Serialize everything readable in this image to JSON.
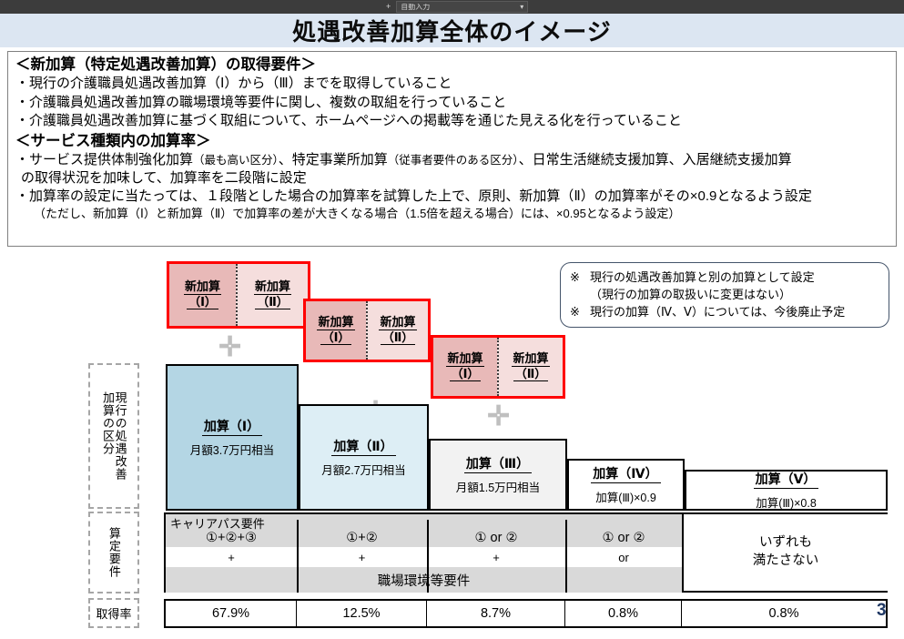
{
  "browser": {
    "plus_label": "+",
    "autofill_select": "自動入力",
    "caret": "▾"
  },
  "slide": {
    "title": "処遇改善加算全体のイメージ",
    "page_number": "3"
  },
  "requirements_box": {
    "section1_heading": "＜新加算（特定処遇改善加算）の取得要件＞",
    "section1_bullets": [
      "現行の介護職員処遇改善加算（Ⅰ）から（Ⅲ）までを取得していること",
      "介護職員処遇改善加算の職場環境等要件に関し、複数の取組を行っていること",
      "介護職員処遇改善加算に基づく取組について、ホームページへの掲載等を通じた見える化を行っていること"
    ],
    "section2_heading": "＜サービス種類内の加算率＞",
    "section2_bullet1_a": "サービス提供体制強化加算",
    "section2_bullet1_b": "（最も高い区分）",
    "section2_bullet1_c": "、特定事業所加算",
    "section2_bullet1_d": "（従事者要件のある区分）",
    "section2_bullet1_e": "、日常生活継続支援加算、入居継続支援加算",
    "section2_bullet1_cont": "の取得状況を加味して、加算率を二段階に設定",
    "section2_bullet2": "加算率の設定に当たっては、１段階とした場合の加算率を試算した上で、原則、新加算（Ⅱ）の加算率がその×0.9となるよう設定",
    "section2_bullet2_sub": "（ただし、新加算（Ⅰ）と新加算（Ⅱ）で加算率の差が大きくなる場合（1.5倍を超える場合）には、×0.95となるよう設定）",
    "bullet_marker": "・"
  },
  "note": {
    "marker": "※",
    "line1": "現行の処遇改善加算と別の加算として設定",
    "line2": "（現行の加算の取扱いに変更はない）",
    "line3": "現行の加算（Ⅳ、Ⅴ）については、今後廃止予定"
  },
  "new_kasan_groups": [
    {
      "one_top": "新加算",
      "one_bottom": "（Ⅰ）",
      "two_top": "新加算",
      "two_bottom": "（Ⅱ）"
    },
    {
      "one_top": "新加算",
      "one_bottom": "（Ⅰ）",
      "two_top": "新加算",
      "two_bottom": "（Ⅱ）"
    },
    {
      "one_top": "新加算",
      "one_bottom": "（Ⅰ）",
      "two_top": "新加算",
      "two_bottom": "（Ⅱ）"
    }
  ],
  "plus_symbol": "✛",
  "side_labels": {
    "current_class_col1": "現行の処遇改善",
    "current_class_col2": "加算の区分",
    "calc_requirements": "算定要件",
    "acquisition_rate": "取得率"
  },
  "tiers": [
    {
      "label": "加算（Ⅰ）",
      "sub": "月額3.7万円相当",
      "color": "#b4d6e4"
    },
    {
      "label": "加算（Ⅱ）",
      "sub": "月額2.7万円相当",
      "color": "#ddeef5"
    },
    {
      "label": "加算（Ⅲ）",
      "sub": "月額1.5万円相当",
      "color": "#f2f2f2"
    },
    {
      "label": "加算（Ⅳ）",
      "sub": "加算(Ⅲ)×0.9",
      "color": "#ffffff"
    },
    {
      "label": "加算（Ⅴ）",
      "sub": "加算(Ⅲ)×0.8",
      "color": "#ffffff"
    }
  ],
  "req_grid": {
    "career_path_label": "キャリアパス要件",
    "columns": [
      {
        "career": "①+②+③",
        "joiner": "+"
      },
      {
        "career": "①+②",
        "joiner": "+"
      },
      {
        "career": "① or ②",
        "joiner": "+"
      },
      {
        "career": "① or ②",
        "joiner": "or"
      }
    ],
    "environment_label": "職場環境等要件",
    "none_line1": "いずれも",
    "none_line2": "満たさない"
  },
  "rates": [
    "67.9%",
    "12.5%",
    "8.7%",
    "0.8%",
    "0.8%"
  ]
}
